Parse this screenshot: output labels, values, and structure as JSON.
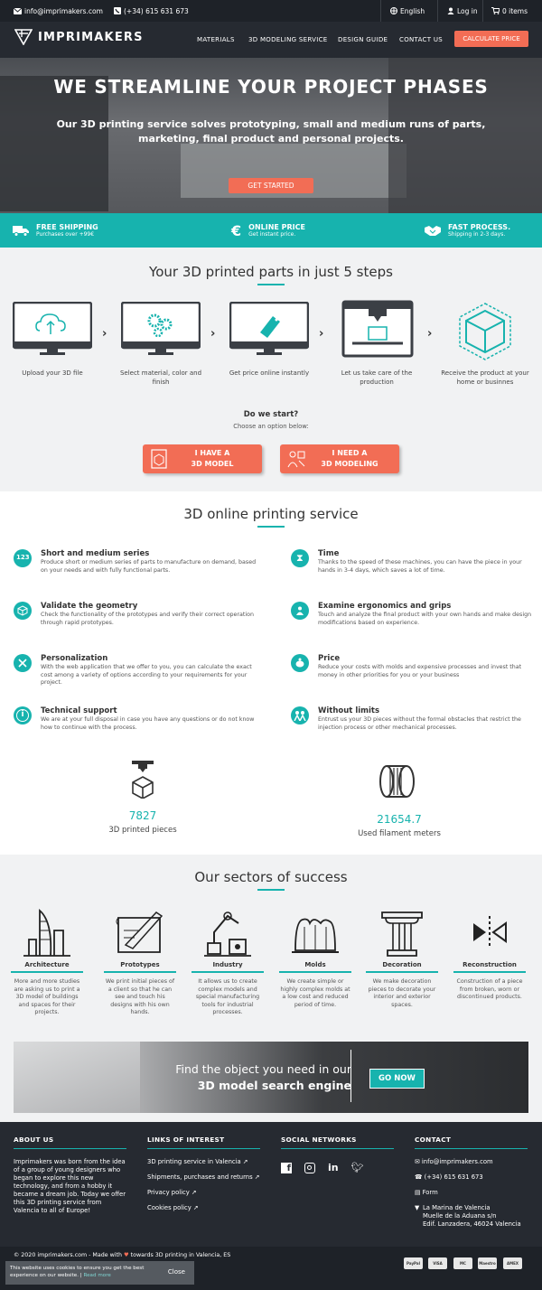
{
  "topbar": {
    "email": "info@imprimakers.com",
    "phone": "(+34) 615 631 673",
    "language": "English",
    "login": "Log in",
    "cart": "0 items"
  },
  "nav": {
    "brand": "IMPRIMAKERS",
    "items": [
      "MATERIALS",
      "3D MODELING SERVICE",
      "DESIGN GUIDE",
      "CONTACT US"
    ],
    "cta": "CALCULATE PRICE"
  },
  "hero": {
    "title": "WE STREAMLINE YOUR PROJECT PHASES",
    "subtitle": "Our 3D printing service solves prototyping, small and medium runs of parts, marketing, final product and personal projects.",
    "cta": "GET STARTED"
  },
  "benefits": [
    {
      "title": "FREE SHIPPING",
      "sub": "Purchases over +99€",
      "icon": "truck-icon"
    },
    {
      "title": "ONLINE PRICE",
      "sub": "Get instant price.",
      "icon": "euro-icon"
    },
    {
      "title": "FAST PROCESS.",
      "sub": "Shipping in 2-3 days.",
      "icon": "handshake-icon"
    }
  ],
  "steps": {
    "title": "Your 3D printed parts in just 5 steps",
    "items": [
      {
        "label": "Upload your 3D file"
      },
      {
        "label": "Select material, color and finish"
      },
      {
        "label": "Get price online instantly"
      },
      {
        "label": "Let us take care of the production"
      },
      {
        "label": "Receive the product at your home or businnes"
      }
    ],
    "question": "Do we start?",
    "choose": "Choose an option below:",
    "option1_line1": "I HAVE A",
    "option1_line2": "3D MODEL",
    "option2_line1": "I NEED A",
    "option2_line2": "3D MODELING"
  },
  "features": {
    "title": "3D online printing service",
    "items": [
      {
        "title": "Short and medium series",
        "text": "Produce short or medium series of parts to manufacture on demand, based on your needs and with fully functional parts."
      },
      {
        "title": "Time",
        "text": "Thanks to the speed of these machines, you can have the piece in your hands in 3-4 days, which saves a lot of time."
      },
      {
        "title": "Validate the geometry",
        "text": "Check the functionality of the prototypes and verify their correct operation through rapid prototypes."
      },
      {
        "title": "Examine ergonomics and grips",
        "text": "Touch and analyze the final product with your own hands and make design modifications based on experience."
      },
      {
        "title": "Personalization",
        "text": "With the web application that we offer to you, you can calculate the exact cost among a variety of options according to your requirements for your project."
      },
      {
        "title": "Price",
        "text": "Reduce your costs with molds and expensive processes and invest that money in other priorities for you or your business"
      },
      {
        "title": "Technical support",
        "text": "We are at your full disposal in case you have any questions or do not know how to continue with the process."
      },
      {
        "title": "Without limits",
        "text": "Entrust us your 3D pieces without the formal obstacles that restrict the injection process or other mechanical processes."
      }
    ],
    "stats": [
      {
        "value": "7827",
        "label": "3D printed pieces"
      },
      {
        "value": "21654.7",
        "label": "Used filament meters"
      }
    ]
  },
  "sectors": {
    "title": "Our sectors of success",
    "items": [
      {
        "name": "Architecture",
        "text": "More and more studies are asking us to print a 3D model of buildings and spaces for their projects."
      },
      {
        "name": "Prototypes",
        "text": "We print initial pieces of a client so that he can see and touch his designs with his own hands."
      },
      {
        "name": "Industry",
        "text": "It allows us to create complex models and special manufacturing tools for industrial processes."
      },
      {
        "name": "Molds",
        "text": "We create simple or highly complex molds at a low cost and reduced period of time."
      },
      {
        "name": "Decoration",
        "text": "We make decoration pieces to decorate your interior and exterior spaces."
      },
      {
        "name": "Reconstruction",
        "text": "Construction of a piece from broken, worn or discontinued products."
      }
    ]
  },
  "search": {
    "line1": "Find the object you need in our",
    "line2": "3D model search engine",
    "cta": "GO NOW"
  },
  "footer": {
    "about": {
      "title": "ABOUT US",
      "text": "Imprimakers was born from the idea of a group of young designers who began to explore this new technology, and from a hobby it became a dream job. Today we offer this 3D printing service from Valencia to all of Europe!"
    },
    "links": {
      "title": "LINKS OF INTEREST",
      "items": [
        "3D printing service in Valencia",
        "Shipments, purchases and returns",
        "Privacy policy",
        "Cookies policy"
      ]
    },
    "social": {
      "title": "SOCIAL NETWORKS",
      "icons": [
        "facebook-icon",
        "instagram-icon",
        "linkedin-icon",
        "twitter-icon"
      ]
    },
    "contact": {
      "title": "CONTACT",
      "email": "info@imprimakers.com",
      "phone": "(+34) 615 631 673",
      "form": "Form",
      "address1": "La Marina de Valencia",
      "address2": "Muelle de la Aduana s/n",
      "address3": "Edif. Lanzadera, 46024 Valencia"
    }
  },
  "bottom": {
    "copyright": "© 2020 imprimakers.com - Made with",
    "copyright_tail": "towards 3D printing in Valencia, ES",
    "payments": [
      "PayPal",
      "VISA",
      "MC",
      "Maestro",
      "AMEX"
    ]
  },
  "cookie": {
    "text": "This website uses cookies to ensure you get the best experience on our website.",
    "link": "Read more",
    "close": "Close"
  },
  "colors": {
    "accent": "#17b3ae",
    "coral": "#f26d55",
    "dark": "#262a31"
  }
}
